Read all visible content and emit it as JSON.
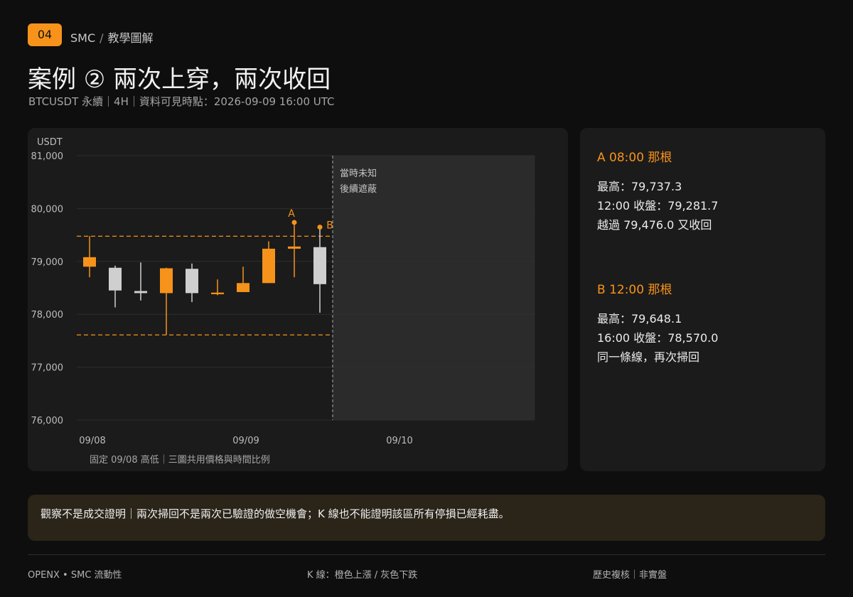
{
  "header": {
    "badge": "04",
    "brand": "SMC",
    "crumb_sep": "/",
    "section": "教學圖解",
    "title": "案例 ② 兩次上穿，兩次收回",
    "subtitle": "BTCUSDT 永續｜4H｜資料可見時點：2026-09-09 16:00 UTC"
  },
  "chart_data": {
    "type": "candlestick",
    "y_unit_label": "USDT",
    "ylim": [
      76000,
      81000
    ],
    "y_ticks": [
      76000,
      77000,
      78000,
      79000,
      80000,
      81000
    ],
    "y_tick_labels": [
      "76,000",
      "77,000",
      "78,000",
      "79,000",
      "80,000",
      "81,000"
    ],
    "x_tick_labels": [
      {
        "t": 0,
        "label": "09/08"
      },
      {
        "t": 6,
        "label": "09/09"
      },
      {
        "t": 12,
        "label": "09/10"
      }
    ],
    "candles": [
      {
        "t": 0,
        "open": 78900,
        "high": 79480,
        "low": 78700,
        "close": 79080
      },
      {
        "t": 1,
        "open": 78880,
        "high": 78920,
        "low": 78130,
        "close": 78450
      },
      {
        "t": 2,
        "open": 78440,
        "high": 78980,
        "low": 78260,
        "close": 78400
      },
      {
        "t": 3,
        "open": 78400,
        "high": 78880,
        "low": 77610,
        "close": 78870
      },
      {
        "t": 4,
        "open": 78860,
        "high": 78960,
        "low": 78230,
        "close": 78400
      },
      {
        "t": 5,
        "open": 78380,
        "high": 78660,
        "low": 78360,
        "close": 78410
      },
      {
        "t": 6,
        "open": 78420,
        "high": 78900,
        "low": 78420,
        "close": 78590
      },
      {
        "t": 7,
        "open": 78590,
        "high": 79380,
        "low": 78590,
        "close": 79240
      },
      {
        "t": 8,
        "open": 79240,
        "high": 79737.3,
        "low": 78700,
        "close": 79281.7
      },
      {
        "t": 9,
        "open": 79270,
        "high": 79648.1,
        "low": 78030,
        "close": 78570.0
      }
    ],
    "levels": [
      {
        "name": "09/08 高",
        "value": 79476.0
      },
      {
        "name": "09/08 低",
        "value": 77610
      }
    ],
    "markers": [
      {
        "label": "A",
        "t": 8,
        "price": 79737.3
      },
      {
        "label": "B",
        "t": 9,
        "price": 79648.1
      }
    ],
    "cutoff_t": 9.5,
    "x_end_t": 17.4,
    "masked_text": [
      "當時未知",
      "後續遮蔽"
    ],
    "note": "固定 09/08 高低｜三圖共用價格與時間比例",
    "colors": {
      "up": "#f7931a",
      "down": "#cfcfcf",
      "level": "#f7931a",
      "grid": "#2e2e2e",
      "mask": "#2b2b2b"
    },
    "grid": true
  },
  "info": {
    "a": {
      "title": "A  08:00 那根",
      "lines": [
        "最高：79,737.3",
        "12:00 收盤：79,281.7",
        "越過 79,476.0 又收回"
      ]
    },
    "b": {
      "title": "B  12:00 那根",
      "lines": [
        "最高：79,648.1",
        "16:00 收盤：78,570.0",
        "同一條線，再次掃回"
      ]
    }
  },
  "warning": "觀察不是成交證明｜兩次掃回不是兩次已驗證的做空機會；K 線也不能證明該區所有停損已經耗盡。",
  "footer": {
    "left": "OPENX • SMC 流動性",
    "center": "K 線：橙色上漲 / 灰色下跌",
    "right": "歷史複核｜非實盤"
  }
}
